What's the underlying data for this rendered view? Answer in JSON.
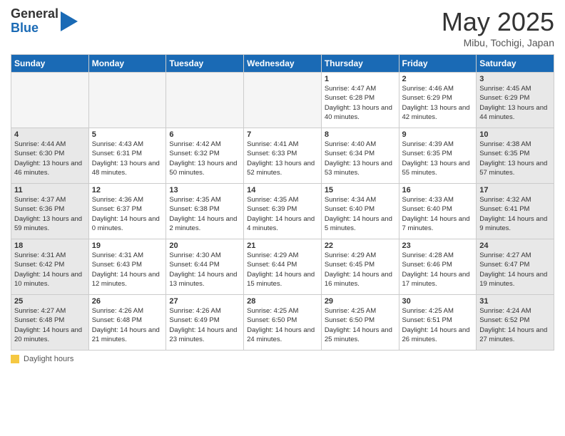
{
  "header": {
    "logo_general": "General",
    "logo_blue": "Blue",
    "title": "May 2025",
    "location": "Mibu, Tochigi, Japan"
  },
  "days_of_week": [
    "Sunday",
    "Monday",
    "Tuesday",
    "Wednesday",
    "Thursday",
    "Friday",
    "Saturday"
  ],
  "weeks": [
    [
      {
        "day": "",
        "empty": true
      },
      {
        "day": "",
        "empty": true
      },
      {
        "day": "",
        "empty": true
      },
      {
        "day": "",
        "empty": true
      },
      {
        "day": "1",
        "sunrise": "Sunrise: 4:47 AM",
        "sunset": "Sunset: 6:28 PM",
        "daylight": "Daylight: 13 hours and 40 minutes."
      },
      {
        "day": "2",
        "sunrise": "Sunrise: 4:46 AM",
        "sunset": "Sunset: 6:29 PM",
        "daylight": "Daylight: 13 hours and 42 minutes."
      },
      {
        "day": "3",
        "sunrise": "Sunrise: 4:45 AM",
        "sunset": "Sunset: 6:29 PM",
        "daylight": "Daylight: 13 hours and 44 minutes."
      }
    ],
    [
      {
        "day": "4",
        "sunrise": "Sunrise: 4:44 AM",
        "sunset": "Sunset: 6:30 PM",
        "daylight": "Daylight: 13 hours and 46 minutes."
      },
      {
        "day": "5",
        "sunrise": "Sunrise: 4:43 AM",
        "sunset": "Sunset: 6:31 PM",
        "daylight": "Daylight: 13 hours and 48 minutes."
      },
      {
        "day": "6",
        "sunrise": "Sunrise: 4:42 AM",
        "sunset": "Sunset: 6:32 PM",
        "daylight": "Daylight: 13 hours and 50 minutes."
      },
      {
        "day": "7",
        "sunrise": "Sunrise: 4:41 AM",
        "sunset": "Sunset: 6:33 PM",
        "daylight": "Daylight: 13 hours and 52 minutes."
      },
      {
        "day": "8",
        "sunrise": "Sunrise: 4:40 AM",
        "sunset": "Sunset: 6:34 PM",
        "daylight": "Daylight: 13 hours and 53 minutes."
      },
      {
        "day": "9",
        "sunrise": "Sunrise: 4:39 AM",
        "sunset": "Sunset: 6:35 PM",
        "daylight": "Daylight: 13 hours and 55 minutes."
      },
      {
        "day": "10",
        "sunrise": "Sunrise: 4:38 AM",
        "sunset": "Sunset: 6:35 PM",
        "daylight": "Daylight: 13 hours and 57 minutes."
      }
    ],
    [
      {
        "day": "11",
        "sunrise": "Sunrise: 4:37 AM",
        "sunset": "Sunset: 6:36 PM",
        "daylight": "Daylight: 13 hours and 59 minutes."
      },
      {
        "day": "12",
        "sunrise": "Sunrise: 4:36 AM",
        "sunset": "Sunset: 6:37 PM",
        "daylight": "Daylight: 14 hours and 0 minutes."
      },
      {
        "day": "13",
        "sunrise": "Sunrise: 4:35 AM",
        "sunset": "Sunset: 6:38 PM",
        "daylight": "Daylight: 14 hours and 2 minutes."
      },
      {
        "day": "14",
        "sunrise": "Sunrise: 4:35 AM",
        "sunset": "Sunset: 6:39 PM",
        "daylight": "Daylight: 14 hours and 4 minutes."
      },
      {
        "day": "15",
        "sunrise": "Sunrise: 4:34 AM",
        "sunset": "Sunset: 6:40 PM",
        "daylight": "Daylight: 14 hours and 5 minutes."
      },
      {
        "day": "16",
        "sunrise": "Sunrise: 4:33 AM",
        "sunset": "Sunset: 6:40 PM",
        "daylight": "Daylight: 14 hours and 7 minutes."
      },
      {
        "day": "17",
        "sunrise": "Sunrise: 4:32 AM",
        "sunset": "Sunset: 6:41 PM",
        "daylight": "Daylight: 14 hours and 9 minutes."
      }
    ],
    [
      {
        "day": "18",
        "sunrise": "Sunrise: 4:31 AM",
        "sunset": "Sunset: 6:42 PM",
        "daylight": "Daylight: 14 hours and 10 minutes."
      },
      {
        "day": "19",
        "sunrise": "Sunrise: 4:31 AM",
        "sunset": "Sunset: 6:43 PM",
        "daylight": "Daylight: 14 hours and 12 minutes."
      },
      {
        "day": "20",
        "sunrise": "Sunrise: 4:30 AM",
        "sunset": "Sunset: 6:44 PM",
        "daylight": "Daylight: 14 hours and 13 minutes."
      },
      {
        "day": "21",
        "sunrise": "Sunrise: 4:29 AM",
        "sunset": "Sunset: 6:44 PM",
        "daylight": "Daylight: 14 hours and 15 minutes."
      },
      {
        "day": "22",
        "sunrise": "Sunrise: 4:29 AM",
        "sunset": "Sunset: 6:45 PM",
        "daylight": "Daylight: 14 hours and 16 minutes."
      },
      {
        "day": "23",
        "sunrise": "Sunrise: 4:28 AM",
        "sunset": "Sunset: 6:46 PM",
        "daylight": "Daylight: 14 hours and 17 minutes."
      },
      {
        "day": "24",
        "sunrise": "Sunrise: 4:27 AM",
        "sunset": "Sunset: 6:47 PM",
        "daylight": "Daylight: 14 hours and 19 minutes."
      }
    ],
    [
      {
        "day": "25",
        "sunrise": "Sunrise: 4:27 AM",
        "sunset": "Sunset: 6:48 PM",
        "daylight": "Daylight: 14 hours and 20 minutes."
      },
      {
        "day": "26",
        "sunrise": "Sunrise: 4:26 AM",
        "sunset": "Sunset: 6:48 PM",
        "daylight": "Daylight: 14 hours and 21 minutes."
      },
      {
        "day": "27",
        "sunrise": "Sunrise: 4:26 AM",
        "sunset": "Sunset: 6:49 PM",
        "daylight": "Daylight: 14 hours and 23 minutes."
      },
      {
        "day": "28",
        "sunrise": "Sunrise: 4:25 AM",
        "sunset": "Sunset: 6:50 PM",
        "daylight": "Daylight: 14 hours and 24 minutes."
      },
      {
        "day": "29",
        "sunrise": "Sunrise: 4:25 AM",
        "sunset": "Sunset: 6:50 PM",
        "daylight": "Daylight: 14 hours and 25 minutes."
      },
      {
        "day": "30",
        "sunrise": "Sunrise: 4:25 AM",
        "sunset": "Sunset: 6:51 PM",
        "daylight": "Daylight: 14 hours and 26 minutes."
      },
      {
        "day": "31",
        "sunrise": "Sunrise: 4:24 AM",
        "sunset": "Sunset: 6:52 PM",
        "daylight": "Daylight: 14 hours and 27 minutes."
      }
    ]
  ],
  "legend": {
    "label": "Daylight hours"
  }
}
